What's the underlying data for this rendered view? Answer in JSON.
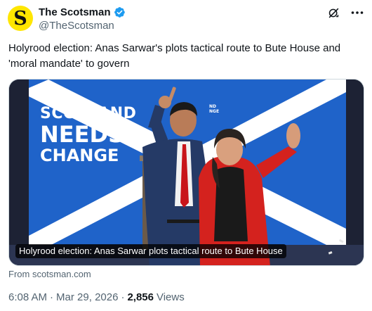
{
  "tweet": {
    "author": {
      "display_name": "The Scotsman",
      "handle": "@TheScotsman",
      "avatar_letter": "S",
      "avatar_color": "#ffe600",
      "verified": true,
      "verified_color": "#1d9bf0"
    },
    "header_icons": [
      "grok-icon",
      "more-icon"
    ],
    "text": "Holyrood election: Anas Sarwar's plots tactical route to Bute House and 'moral mandate' to govern",
    "card": {
      "image": {
        "slogan_line1": "SCOTLAND",
        "slogan_line2": "NEEDS",
        "slogan_line3": "CHANGE",
        "board_line1": "ND",
        "board_line2": "NGE",
        "board_color": "#1f63c9"
      },
      "caption": "Holyrood election: Anas Sarwar plots tactical route to Bute House"
    },
    "source": "From scotsman.com",
    "time": "6:08 AM",
    "date": "Mar 29, 2026",
    "separator": "·",
    "views_count": "2,856",
    "views_label": "Views"
  }
}
